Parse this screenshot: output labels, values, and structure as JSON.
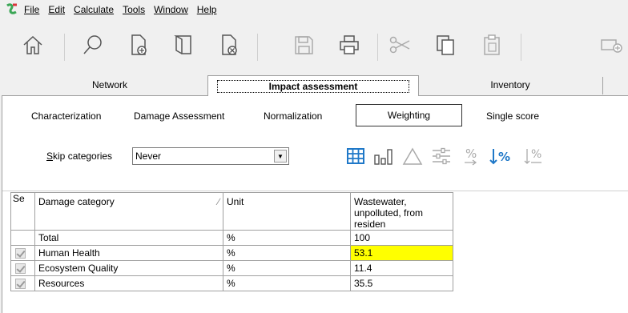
{
  "menu": [
    "File",
    "Edit",
    "Calculate",
    "Tools",
    "Window",
    "Help"
  ],
  "toolbar_icons": [
    "home-icon",
    "search-icon",
    "new-document-icon",
    "open-icon",
    "close-document-icon",
    "save-icon",
    "print-icon",
    "cut-icon",
    "copy-icon",
    "paste-icon",
    "insert-icon"
  ],
  "tabs": {
    "network": "Network",
    "impact": "Impact assessment",
    "inventory": "Inventory"
  },
  "subtabs": {
    "characterization": "Characterization",
    "damage": "Damage Assessment",
    "normalization": "Normalization",
    "weighting": "Weighting",
    "single_score": "Single score"
  },
  "skip": {
    "label_prefix": "S",
    "label_rest": "kip categories",
    "value": "Never"
  },
  "table": {
    "headers": {
      "se": "Se",
      "category": "Damage category",
      "unit": "Unit",
      "value": "Wastewater, unpolluted, from residen"
    },
    "rows": [
      {
        "category": "Total",
        "unit": "%",
        "value": "100",
        "checked": false
      },
      {
        "category": "Human Health",
        "unit": "%",
        "value": "53.1",
        "checked": true
      },
      {
        "category": "Ecosystem Quality",
        "unit": "%",
        "value": "11.4",
        "checked": true
      },
      {
        "category": "Resources",
        "unit": "%",
        "value": "35.5",
        "checked": true
      }
    ]
  },
  "colors": {
    "accent": "#1f78c8",
    "highlight": "#ffff00",
    "logo_green": "#3aa655",
    "logo_red": "#d9343a"
  }
}
